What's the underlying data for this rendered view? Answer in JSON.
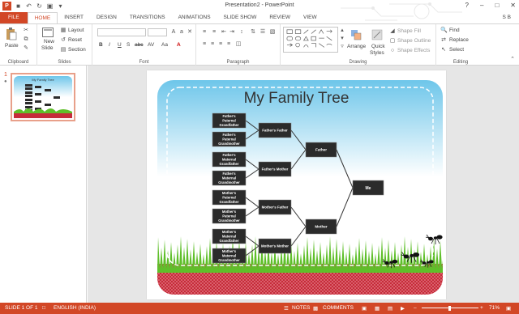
{
  "window": {
    "title": "Presentation2 - PowerPoint",
    "user": "S B",
    "controls": [
      "?",
      "–",
      "□",
      "✕"
    ]
  },
  "tabs": [
    "FILE",
    "HOME",
    "INSERT",
    "DESIGN",
    "TRANSITIONS",
    "ANIMATIONS",
    "SLIDE SHOW",
    "REVIEW",
    "VIEW"
  ],
  "active_tab": "HOME",
  "ribbon": {
    "clipboard": {
      "paste": "Paste",
      "label": "Clipboard"
    },
    "slides": {
      "new_slide": "New",
      "new_slide2": "Slide",
      "layout": "Layout",
      "reset": "Reset",
      "section": "Section",
      "label": "Slides"
    },
    "font": {
      "bold": "B",
      "italic": "I",
      "underline": "U",
      "strike": "S",
      "shadow": "abc",
      "spacing": "AV",
      "case": "Aa",
      "color": "A",
      "label": "Font"
    },
    "paragraph": {
      "label": "Paragraph"
    },
    "drawing": {
      "arrange": "Arrange",
      "quick_styles": "Quick",
      "quick_styles2": "Styles",
      "shape_fill": "Shape Fill",
      "shape_outline": "Shape Outline",
      "shape_effects": "Shape Effects",
      "label": "Drawing"
    },
    "editing": {
      "find": "Find",
      "replace": "Replace",
      "select": "Select",
      "label": "Editing"
    }
  },
  "thumbnail": {
    "number": "1",
    "title": "My Family Tree"
  },
  "slide": {
    "title": "My Family Tree",
    "colors": {
      "sky_top": "#6ec6ea",
      "sky_bottom": "#ffffff",
      "grass": "#5fbf2a",
      "ground": "#c62b3a",
      "box": "#2b2b2b"
    },
    "boxes": {
      "gen3": [
        "Father's Paternal Grandfather",
        "Father's Paternal Grandmother",
        "Father's Maternal Grandfather",
        "Father's Maternal Grandmother",
        "Mother's Paternal Grandfather",
        "Mother's Paternal Grandmother",
        "Mother's Maternal Grandfather",
        "Mother's Maternal Grandmother"
      ],
      "gen2": [
        "Father's Father",
        "Father's Mother",
        "Mother's Father",
        "Mother's Mother"
      ],
      "gen1": [
        "Father",
        "Mother"
      ],
      "me": "Me"
    }
  },
  "status": {
    "slide": "SLIDE 1 OF 1",
    "language": "ENGLISH (INDIA)",
    "notes": "NOTES",
    "comments": "COMMENTS",
    "zoom": "71%"
  }
}
